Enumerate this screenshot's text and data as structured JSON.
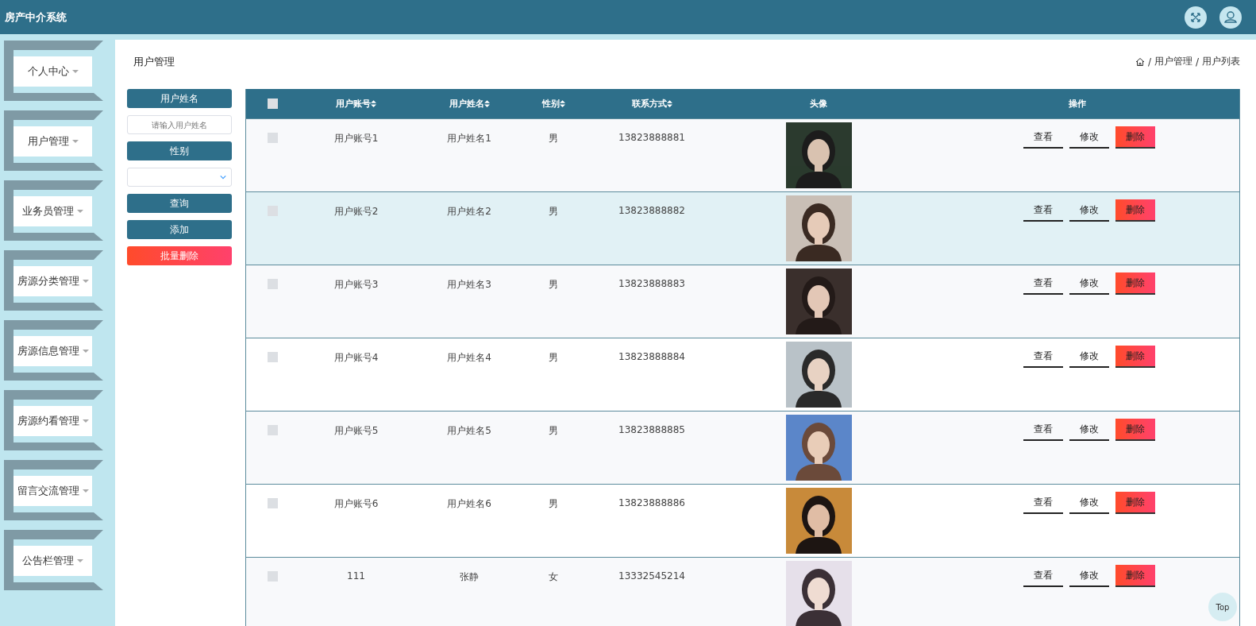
{
  "header": {
    "title": "房产中介系统"
  },
  "sidebar": {
    "items": [
      {
        "label": "个人中心"
      },
      {
        "label": "用户管理"
      },
      {
        "label": "业务员管理"
      },
      {
        "label": "房源分类管理"
      },
      {
        "label": "房源信息管理"
      },
      {
        "label": "房源约看管理"
      },
      {
        "label": "留言交流管理"
      },
      {
        "label": "公告栏管理"
      }
    ]
  },
  "page_title": "用户管理",
  "breadcrumb": {
    "separator": "/",
    "items": [
      "用户管理",
      "用户列表"
    ]
  },
  "filters": {
    "name_label": "用户姓名",
    "name_placeholder": "请输入用户姓名",
    "gender_label": "性别",
    "buttons": [
      {
        "label": "查询",
        "kind": "primary"
      },
      {
        "label": "添加",
        "kind": "primary"
      },
      {
        "label": "批量删除",
        "kind": "danger"
      }
    ]
  },
  "table": {
    "all_checked": false,
    "columns": [
      {
        "label": "用户账号",
        "sortable": true
      },
      {
        "label": "用户姓名",
        "sortable": true
      },
      {
        "label": "性别",
        "sortable": true
      },
      {
        "label": "联系方式",
        "sortable": true
      },
      {
        "label": "头像",
        "sortable": false
      },
      {
        "label": "操作",
        "sortable": false
      }
    ],
    "rows": [
      {
        "checked": false,
        "highlighted": false,
        "account": "用户账号1",
        "name": "用户姓名1",
        "gender": "男",
        "phone": "13823888881",
        "actions": [
          "查看",
          "修改",
          "删除"
        ]
      },
      {
        "checked": false,
        "highlighted": true,
        "account": "用户账号2",
        "name": "用户姓名2",
        "gender": "男",
        "phone": "13823888882",
        "actions": [
          "查看",
          "修改",
          "删除"
        ]
      },
      {
        "checked": false,
        "highlighted": false,
        "account": "用户账号3",
        "name": "用户姓名3",
        "gender": "男",
        "phone": "13823888883",
        "actions": [
          "查看",
          "修改",
          "删除"
        ]
      },
      {
        "checked": false,
        "highlighted": false,
        "account": "用户账号4",
        "name": "用户姓名4",
        "gender": "男",
        "phone": "13823888884",
        "actions": [
          "查看",
          "修改",
          "删除"
        ]
      },
      {
        "checked": false,
        "highlighted": false,
        "account": "用户账号5",
        "name": "用户姓名5",
        "gender": "男",
        "phone": "13823888885",
        "actions": [
          "查看",
          "修改",
          "删除"
        ]
      },
      {
        "checked": false,
        "highlighted": false,
        "account": "用户账号6",
        "name": "用户姓名6",
        "gender": "男",
        "phone": "13823888886",
        "actions": [
          "查看",
          "修改",
          "删除"
        ]
      },
      {
        "checked": false,
        "highlighted": false,
        "account": "111",
        "name": "张静",
        "gender": "女",
        "phone": "13332545214",
        "actions": [
          "查看",
          "修改",
          "删除"
        ]
      }
    ]
  },
  "back_to_top": "Top"
}
